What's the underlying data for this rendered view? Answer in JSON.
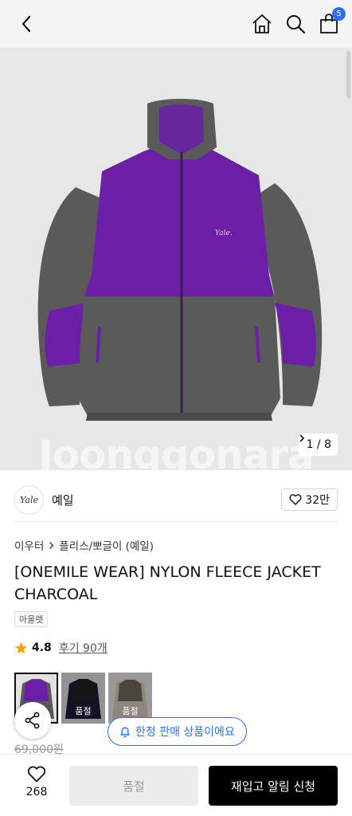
{
  "header": {
    "cart_count": "5"
  },
  "hero": {
    "watermark": "Joonggonara",
    "counter": "1 / 8"
  },
  "brand": {
    "logo_text": "Yale",
    "name": "예일",
    "like_count": "32만"
  },
  "breadcrumb": {
    "category": "이우터",
    "subcategory": "플리스/뽀글이 (예일)"
  },
  "product": {
    "title": "[ONEMILE WEAR] NYLON FLEECE JACKET CHARCOAL",
    "tag": "아울렛",
    "rating": "4.8",
    "reviews": "후기 90개",
    "price": "69,000원"
  },
  "thumbnails": [
    {
      "soldout": ""
    },
    {
      "soldout": "품절"
    },
    {
      "soldout": "품절"
    }
  ],
  "notice": {
    "limited": "한정 판매 상품이에요"
  },
  "bottom": {
    "wish_count": "268",
    "soldout_label": "품절",
    "restock_label": "재입고 알림 신청"
  },
  "colors": {
    "accent": "#2f6ff5",
    "jacket_purple": "#6a1fa6",
    "jacket_gray": "#5a5a5a",
    "star": "#f5a100"
  }
}
